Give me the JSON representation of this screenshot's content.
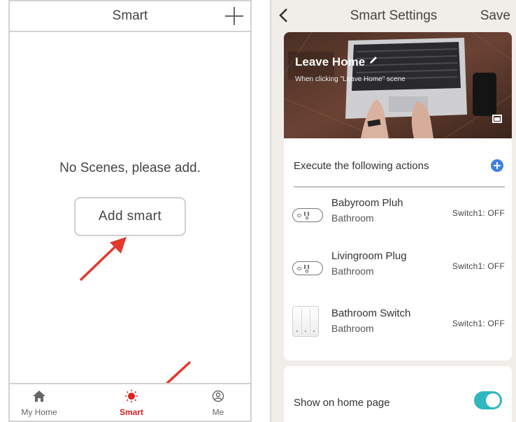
{
  "left": {
    "header": {
      "title": "Smart"
    },
    "empty_message": "No Scenes, please add.",
    "add_button_label": "Add  smart",
    "tabs": [
      {
        "label": "My Home",
        "icon": "home-icon",
        "active": false
      },
      {
        "label": "Smart",
        "icon": "sun-icon",
        "active": true
      },
      {
        "label": "Me",
        "icon": "user-icon",
        "active": false
      }
    ]
  },
  "right": {
    "header": {
      "title": "Smart Settings",
      "save_label": "Save"
    },
    "scene": {
      "name": "Leave Home",
      "subtitle": "When clicking \"Leave Home\" scene"
    },
    "actions_title": "Execute the following actions",
    "devices": [
      {
        "name": "Babyroom Pluh",
        "room": "Bathroom",
        "status": "Switch1: OFF",
        "icon": "plug-icon"
      },
      {
        "name": "Livingroom Plug",
        "room": "Bathroom",
        "status": "Switch1: OFF",
        "icon": "plug-icon"
      },
      {
        "name": "Bathroom Switch",
        "room": "Bathroom",
        "status": "Switch1: OFF",
        "icon": "wall-switch-icon"
      }
    ],
    "show_on_home_label": "Show on home page",
    "show_on_home": true
  },
  "colors": {
    "accent_red": "#e02020",
    "toggle_teal": "#2fb7bd",
    "add_blue": "#3f7fe0"
  }
}
